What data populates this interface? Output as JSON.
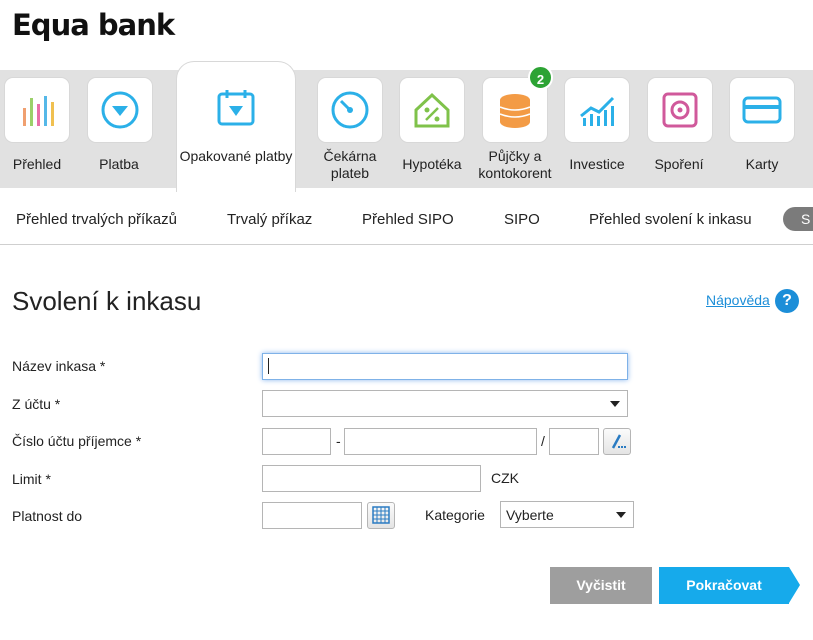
{
  "brand": {
    "logo_text": "Equa bank"
  },
  "nav": {
    "items": [
      {
        "label": "Přehled",
        "icon": "bar-chart-icon"
      },
      {
        "label": "Platba",
        "icon": "arrow-down-circle-icon"
      },
      {
        "label": "Opakované platby",
        "icon": "calendar-arrow-icon",
        "active": true
      },
      {
        "label": "Čekárna plateb",
        "icon": "clock-gauge-icon"
      },
      {
        "label": "Hypotéka",
        "icon": "house-percent-icon"
      },
      {
        "label": "Půjčky a kontokorent",
        "icon": "coin-stack-icon",
        "badge": "2"
      },
      {
        "label": "Investice",
        "icon": "growth-chart-icon"
      },
      {
        "label": "Spoření",
        "icon": "safe-icon"
      },
      {
        "label": "Karty",
        "icon": "credit-card-icon"
      }
    ]
  },
  "subnav": {
    "items": [
      "Přehled trvalých příkazů",
      "Trvalý příkaz",
      "Přehled SIPO",
      "SIPO",
      "Přehled svolení k inkasu"
    ],
    "pill_label": "S"
  },
  "page": {
    "title": "Svolení k inkasu",
    "help_label": "Nápověda",
    "help_icon_text": "?"
  },
  "form": {
    "name_label": "Název inkasa *",
    "name_value": "",
    "from_account_label": "Z účtu *",
    "from_account_value": "",
    "recipient_label": "Číslo účtu příjemce *",
    "prefix_value": "",
    "dash": "-",
    "number_value": "",
    "slash": "/",
    "bank_code_value": "",
    "limit_label": "Limit *",
    "limit_value": "",
    "currency": "CZK",
    "valid_until_label": "Platnost do",
    "valid_until_value": "",
    "category_label": "Kategorie",
    "category_value": "Vyberte"
  },
  "actions": {
    "clear_label": "Vyčistit",
    "continue_label": "Pokračovat"
  },
  "colors": {
    "accent": "#16aaeb",
    "badge": "#2ca334",
    "clear_button": "#9e9e9e",
    "nav_bg": "#e1e1e1"
  }
}
